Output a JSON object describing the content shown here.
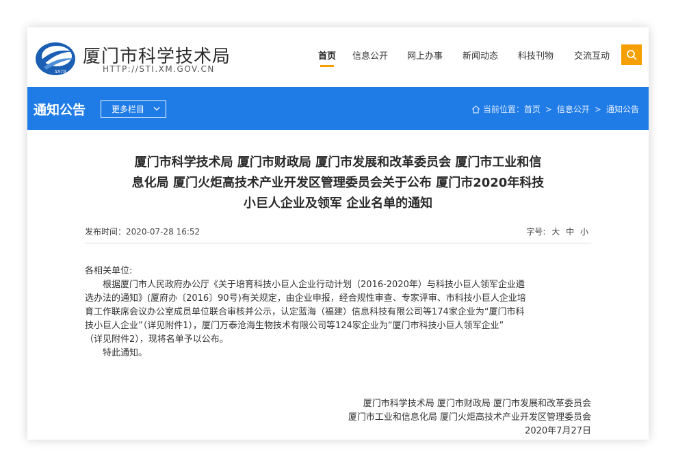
{
  "header": {
    "site_name": "厦门市科学技术局",
    "site_url": "HTTP://STI.XM.GOV.CN",
    "logo_text": "XSTB",
    "nav": [
      {
        "label": "首页",
        "active": true
      },
      {
        "label": "信息公开",
        "active": false
      },
      {
        "label": "网上办事",
        "active": false
      },
      {
        "label": "新闻动态",
        "active": false
      },
      {
        "label": "科技刊物",
        "active": false
      },
      {
        "label": "交流互动",
        "active": false
      }
    ],
    "search_icon": "search-icon"
  },
  "bluebar": {
    "section_title": "通知公告",
    "more_label": "更多栏目",
    "breadcrumb": {
      "prefix": "当前位置：",
      "items": [
        "首页",
        "信息公开",
        "通知公告"
      ],
      "separator": ">"
    }
  },
  "article": {
    "title_lines": [
      "厦门市科学技术局 厦门市财政局 厦门市发展和改革委员会 厦门市工业和信",
      "息化局 厦门火炬高技术产业开发区管理委员会关于公布 厦门市2020年科技",
      "小巨人企业及领军 企业名单的通知"
    ],
    "publish_label": "发布时间：",
    "publish_time": "2020-07-28 16:52",
    "font_size_label": "字号:",
    "font_sizes": [
      "大",
      "中",
      "小"
    ],
    "salutation": "各相关单位:",
    "paragraph_lines": [
      "根据厦门市人民政府办公厅《关于培育科技小巨人企业行动计划（2016-2020年）与科技小巨人领军企业遴",
      "选办法的通知》(厦府办〔2016〕90号)有关规定，由企业申报，经合规性审查、专家评审、市科技小巨人企业培",
      "育工作联席会议办公室成员单位联合审核并公示，认定蓝海（福建）信息科技有限公司等174家企业为“厦门市科",
      "技小巨人企业”（详见附件1），厦门万泰沧海生物技术有限公司等124家企业为“厦门市科技小巨人领军企业”",
      "（详见附件2），现将名单予以公布。"
    ],
    "closing": "特此通知。",
    "signature_lines": [
      "厦门市科学技术局   厦门市财政局  厦门市发展和改革委员会",
      "厦门市工业和信息化局   厦门火炬高技术产业开发区管理委员会",
      "2020年7月27日"
    ]
  },
  "colors": {
    "accent_orange": "#f5a000",
    "bar_blue": "#1f7be6",
    "logo_blue": "#1a5fb4"
  }
}
